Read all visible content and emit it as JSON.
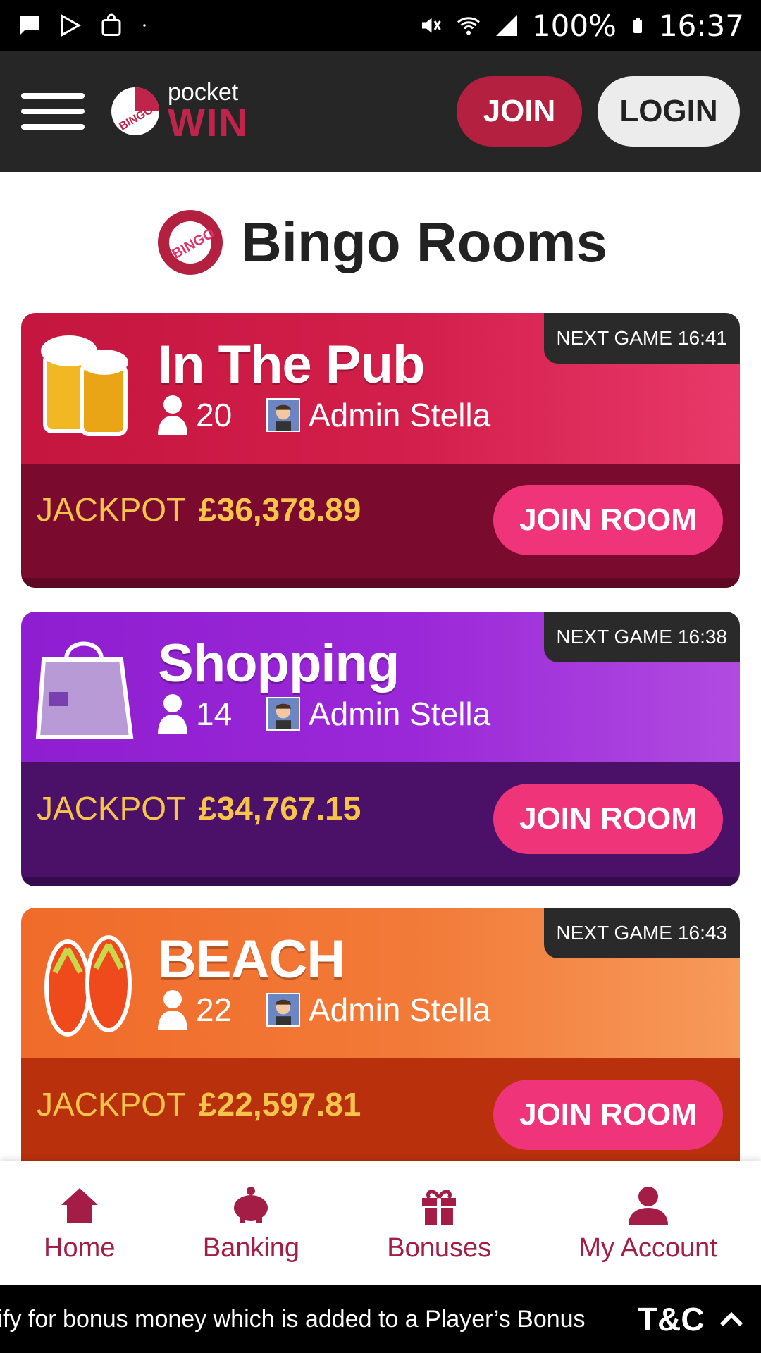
{
  "status_bar": {
    "battery": "100%",
    "time": "16:37"
  },
  "header": {
    "logo_small": "pocket",
    "logo_big": "WIN",
    "logo_badge": "BINGO",
    "join_label": "JOIN",
    "login_label": "LOGIN"
  },
  "page": {
    "title": "Bingo Rooms",
    "title_badge": "BINGO"
  },
  "rooms": [
    {
      "name": "In The Pub",
      "players": "20",
      "admin": "Admin Stella",
      "next_game_label": "NEXT GAME",
      "next_game_time": "16:41",
      "jackpot_label": "JACKPOT",
      "jackpot_amount": "£36,378.89",
      "join_label": "JOIN ROOM",
      "colors": {
        "top": "#c4163f",
        "bottom": "#7a0b2f",
        "lip": "#5e0822"
      }
    },
    {
      "name": "Shopping",
      "players": "14",
      "admin": "Admin Stella",
      "next_game_label": "NEXT GAME",
      "next_game_time": "16:38",
      "jackpot_label": "JACKPOT",
      "jackpot_amount": "£34,767.15",
      "join_label": "JOIN ROOM",
      "colors": {
        "top": "#8e1ed0",
        "bottom": "#4b1168",
        "lip": "#360b4d"
      }
    },
    {
      "name": "BEACH",
      "players": "22",
      "admin": "Admin Stella",
      "next_game_label": "NEXT GAME",
      "next_game_time": "16:43",
      "jackpot_label": "JACKPOT",
      "jackpot_amount": "£22,597.81",
      "join_label": "JOIN ROOM",
      "colors": {
        "top": "#f06b2a",
        "bottom": "#b8300c",
        "lip": "#8e2508"
      }
    }
  ],
  "bottom_nav": {
    "items": [
      {
        "label": "Home",
        "icon": "home-icon"
      },
      {
        "label": "Banking",
        "icon": "piggy-bank-icon"
      },
      {
        "label": "Bonuses",
        "icon": "gift-icon"
      },
      {
        "label": "My Account",
        "icon": "user-icon"
      }
    ]
  },
  "tc_bar": {
    "ticker": "alify for bonus money which is added to a Player’s Bonus",
    "label": "T&C"
  },
  "colors": {
    "brand_red": "#b4203f",
    "join_room_pink": "#f0347a",
    "jackpot_gold": "#f6c44a",
    "nav_crimson": "#a31d46"
  }
}
